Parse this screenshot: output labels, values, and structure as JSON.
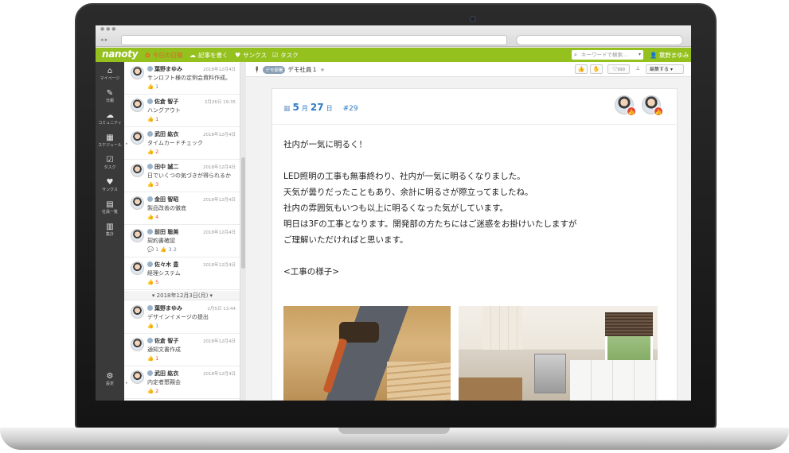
{
  "browser": {
    "nav_label": "◂ ▸",
    "traffic": "● ● ●"
  },
  "app": {
    "logo": "nanoty",
    "nav": [
      {
        "label": "今日の日報",
        "icon": "flower-icon"
      },
      {
        "label": "記事を書く",
        "icon": "chat-icon"
      },
      {
        "label": "サンクス",
        "icon": "heart-icon"
      },
      {
        "label": "タスク",
        "icon": "checkbox-icon"
      }
    ],
    "search_placeholder": "キーワードで検索...",
    "user": "葉野まゆみ"
  },
  "sidebar": [
    {
      "label": "マイページ",
      "icon": "⌂"
    },
    {
      "label": "日報",
      "icon": "✎"
    },
    {
      "label": "コミュニティ",
      "icon": "☁"
    },
    {
      "label": "スケジュール",
      "icon": "▦"
    },
    {
      "label": "タスク",
      "icon": "☑"
    },
    {
      "label": "サンクス",
      "icon": "♥"
    },
    {
      "label": "社員一覧",
      "icon": "▤"
    },
    {
      "label": "集計",
      "icon": "▥"
    }
  ],
  "sidebar_settings": {
    "label": "設定",
    "icon": "⚙"
  },
  "feed": {
    "items_top": [
      {
        "name": "葉野まゆみ",
        "date": "2018年12月4日",
        "text": "サンロフト様の定例会資料作成。",
        "likes_b": "1",
        "likes_r": "",
        "extra": ""
      },
      {
        "name": "佐倉 智子",
        "date": "2月26日 19:35",
        "text": "ハングアウト",
        "likes_b": "",
        "likes_r": "1",
        "extra": ""
      },
      {
        "name": "武田 紘衣",
        "date": "2018年12月4日",
        "text": "タイムカードチェック",
        "likes_b": "",
        "likes_r": "2",
        "extra": ""
      },
      {
        "name": "田中 誠二",
        "date": "2018年12月4日",
        "text": "日でいくつの気づきが得られるか",
        "likes_b": "",
        "likes_r": "3",
        "extra": ""
      },
      {
        "name": "金田 智昭",
        "date": "2018年12月4日",
        "text": "製品改善の徹底",
        "likes_b": "",
        "likes_r": "4",
        "extra": ""
      },
      {
        "name": "前田 聡美",
        "date": "2018年12月4日",
        "text": "契約書確認",
        "likes_b": "1",
        "likes_r": "",
        "extra": "3  2"
      },
      {
        "name": "佐々木 豊",
        "date": "2018年12月4日",
        "text": "経理システム",
        "likes_b": "",
        "likes_r": "5",
        "extra": ""
      }
    ],
    "divider": "2018年12月3日(月)",
    "items_bottom": [
      {
        "name": "葉野まゆみ",
        "date": "2月5日 13:44",
        "text": "デザインイメージの提出",
        "likes_b": "1",
        "likes_r": ""
      },
      {
        "name": "佐倉 智子",
        "date": "2018年12月4日",
        "text": "通知文書作成",
        "likes_b": "",
        "likes_r": "1"
      },
      {
        "name": "武田 紘衣",
        "date": "2018年12月4日",
        "text": "内定者懇親会",
        "likes_b": "",
        "likes_r": "2"
      }
    ]
  },
  "toolbar": {
    "tag": "デモ部署",
    "author": "デモ社員１",
    "count_label": "999",
    "edit_label": "編集する"
  },
  "post": {
    "month": "5",
    "month_unit": "月",
    "day": "27",
    "day_unit": "日",
    "number": "#29",
    "title": "社内が一気に明るく！",
    "lines": [
      "LED照明の工事も無事終わり、社内が一気に明るくなりました。",
      "天気が曇りだったこともあり、余計に明るさが際立ってましたね。",
      "社内の雰囲気もいつも以上に明るくなった気がしています。",
      "明日は3Fの工事となります。開発部の方たちにはご迷惑をお掛けいたしますが",
      "ご理解いただければと思います。"
    ],
    "section": "<工事の様子>",
    "reaction_badge": "👍"
  },
  "colors": {
    "accent": "#95c11f",
    "link": "#2f7ac4",
    "like": "#e0483a"
  }
}
